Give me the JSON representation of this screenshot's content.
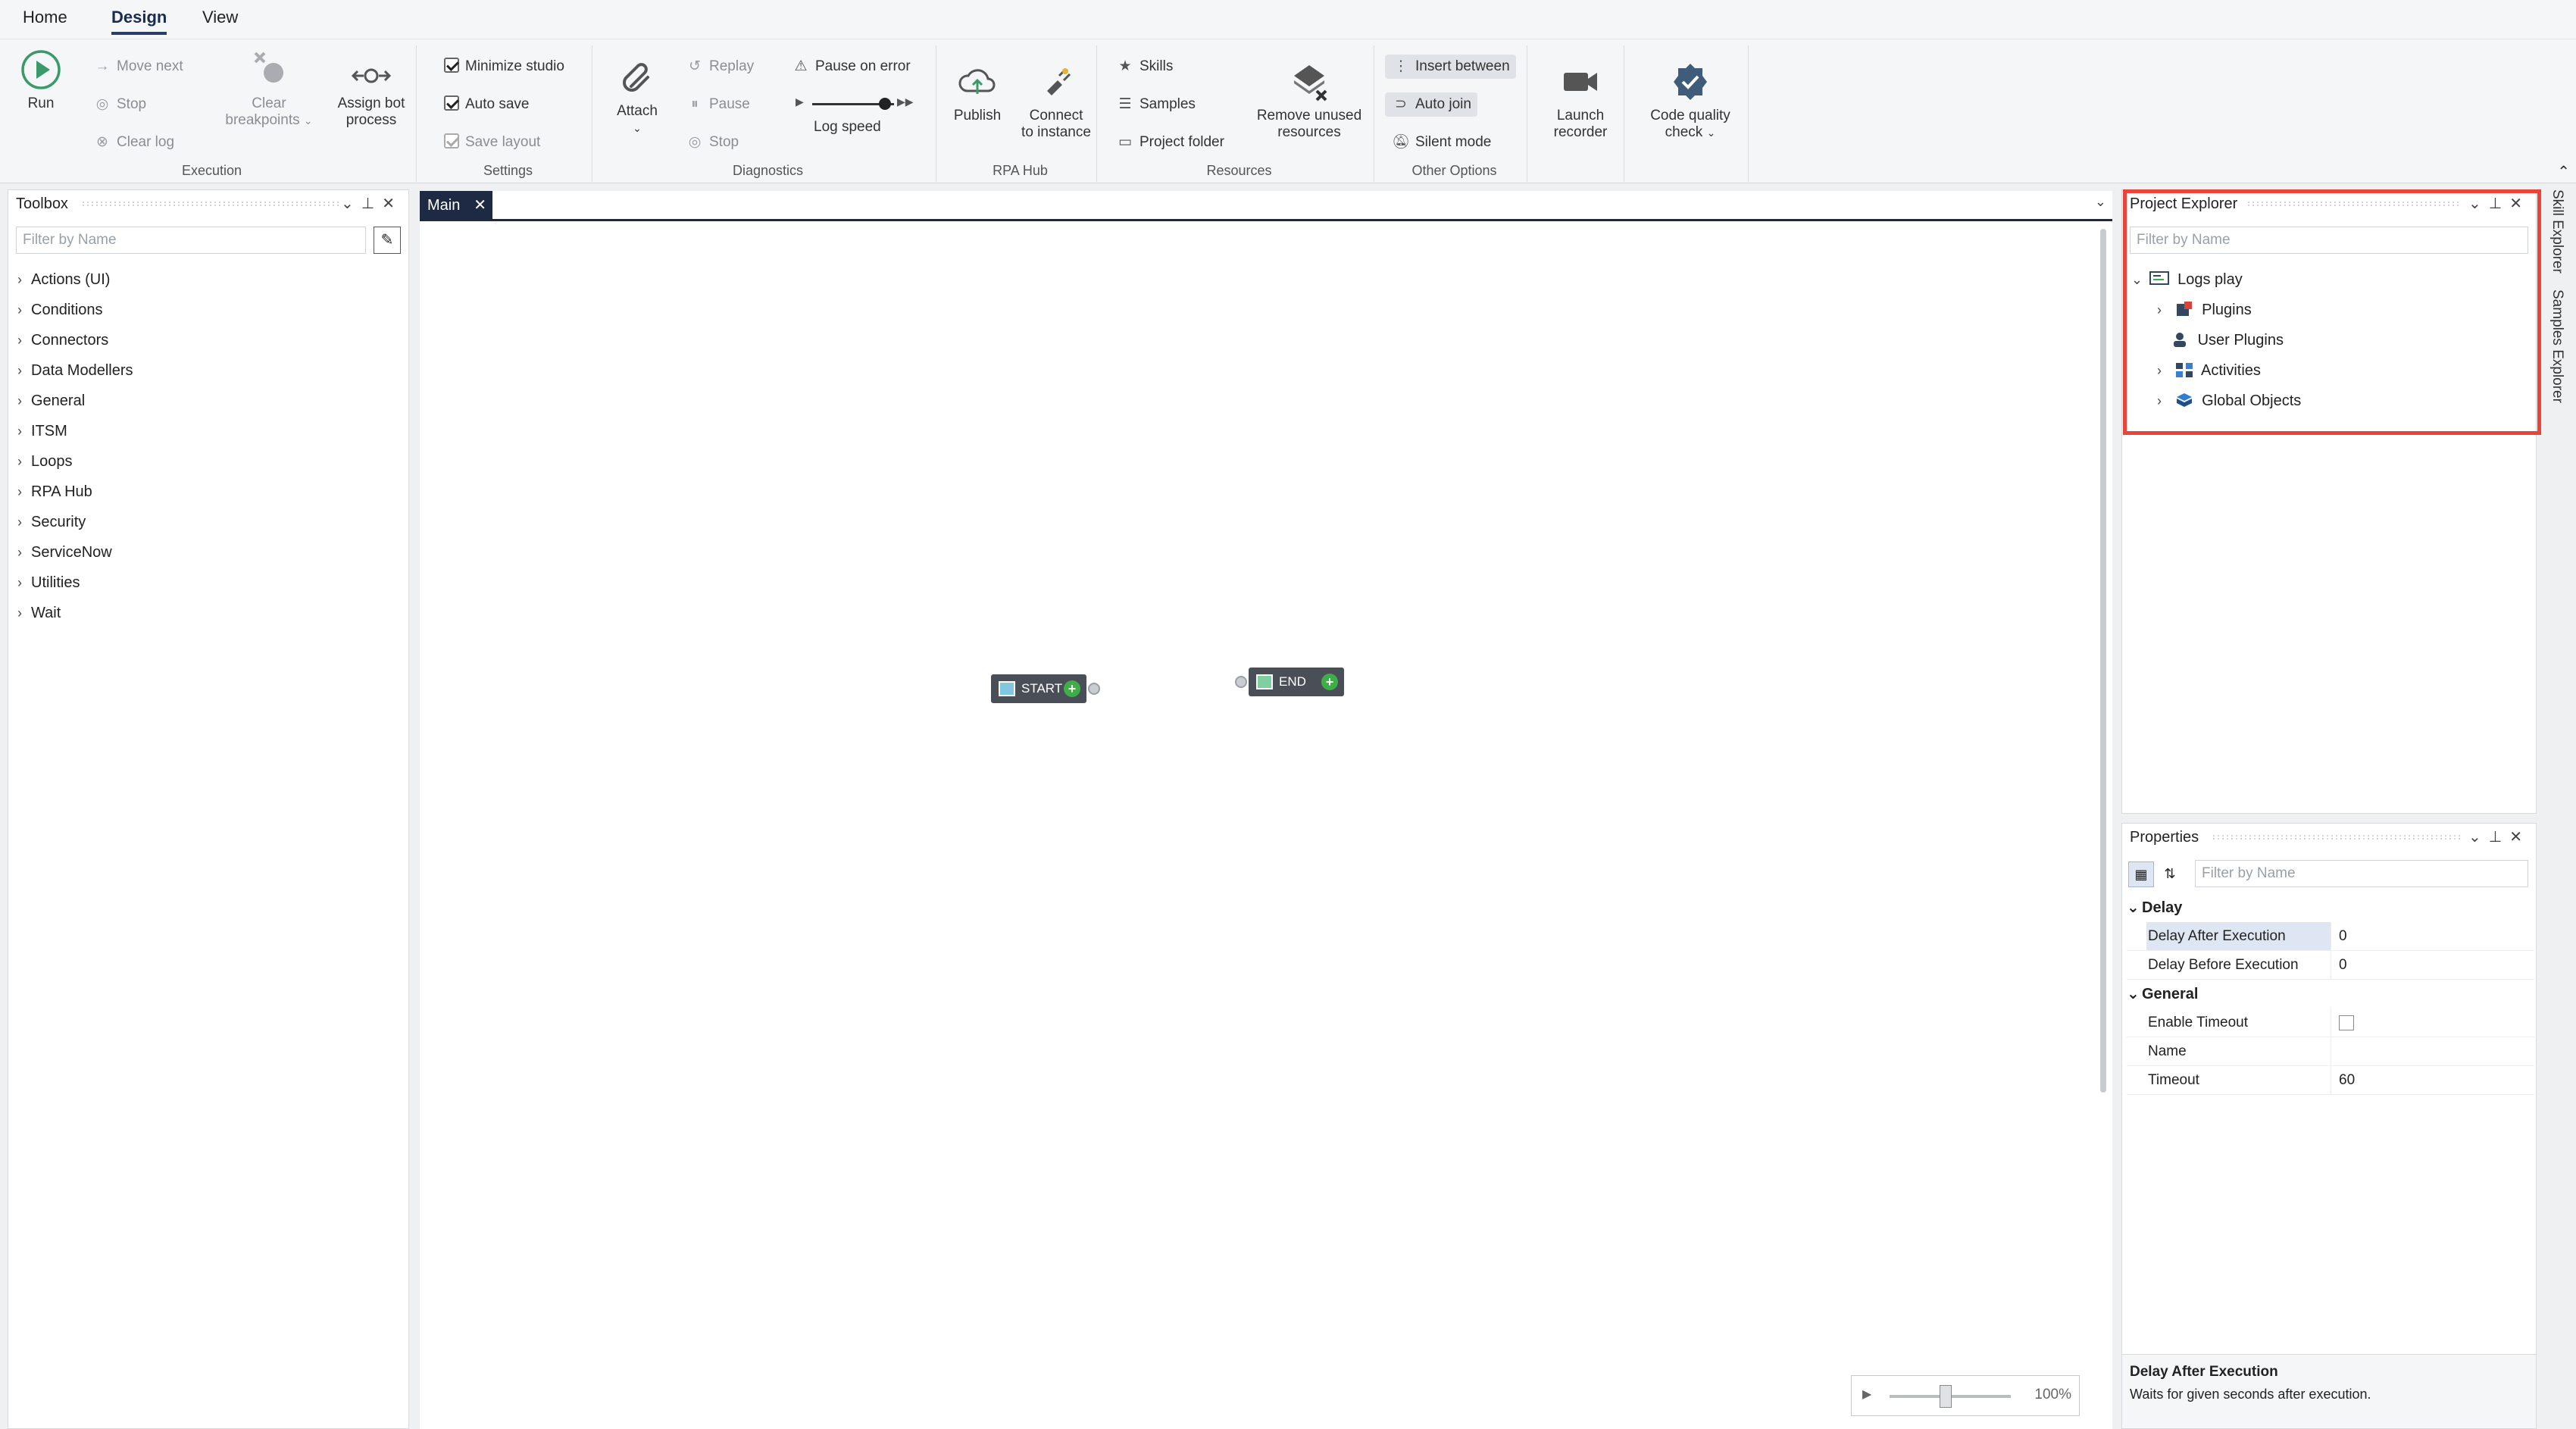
{
  "tabs": [
    "Home",
    "Design",
    "View"
  ],
  "active_tab": "Design",
  "ribbon": {
    "execution": {
      "label": "Execution",
      "run": "Run",
      "move_next": "Move next",
      "stop": "Stop",
      "clear_log": "Clear log",
      "clear_breakpoints_1": "Clear",
      "clear_breakpoints_2": "breakpoints",
      "assign_bot_1": "Assign bot",
      "assign_bot_2": "process"
    },
    "settings": {
      "label": "Settings",
      "minimize_studio": "Minimize studio",
      "auto_save": "Auto save",
      "save_layout": "Save layout"
    },
    "diagnostics": {
      "label": "Diagnostics",
      "attach": "Attach",
      "replay": "Replay",
      "pause": "Pause",
      "stop": "Stop",
      "pause_on_error": "Pause on error",
      "log_speed": "Log speed"
    },
    "rpa_hub": {
      "label": "RPA Hub",
      "publish": "Publish",
      "connect_1": "Connect",
      "connect_2": "to instance"
    },
    "resources": {
      "label": "Resources",
      "skills": "Skills",
      "samples": "Samples",
      "project_folder": "Project folder",
      "remove_unused_1": "Remove unused",
      "remove_unused_2": "resources"
    },
    "other_options": {
      "label": "Other Options",
      "insert_between": "Insert between",
      "auto_join": "Auto join",
      "silent_mode": "Silent mode"
    },
    "launch_recorder_1": "Launch",
    "launch_recorder_2": "recorder",
    "code_quality_1": "Code quality",
    "code_quality_2": "check"
  },
  "toolbox": {
    "title": "Toolbox",
    "filter_placeholder": "Filter by Name",
    "items": [
      "Actions (UI)",
      "Conditions",
      "Connectors",
      "Data Modellers",
      "General",
      "ITSM",
      "Loops",
      "RPA Hub",
      "Security",
      "ServiceNow",
      "Utilities",
      "Wait"
    ]
  },
  "document": {
    "tab": "Main",
    "nodes": {
      "start": "START",
      "end": "END"
    },
    "zoom": "100%"
  },
  "project_explorer": {
    "title": "Project Explorer",
    "filter_placeholder": "Filter by Name",
    "root": "Logs play",
    "children": [
      "Plugins",
      "User Plugins",
      "Activities",
      "Global Objects"
    ]
  },
  "properties": {
    "title": "Properties",
    "filter_placeholder": "Filter by Name",
    "categories": [
      {
        "name": "Delay",
        "rows": [
          {
            "name": "Delay After Execution",
            "value": "0"
          },
          {
            "name": "Delay Before Execution",
            "value": "0"
          }
        ]
      },
      {
        "name": "General",
        "rows": [
          {
            "name": "Enable Timeout",
            "value": ""
          },
          {
            "name": "Name",
            "value": ""
          },
          {
            "name": "Timeout",
            "value": "60"
          }
        ]
      }
    ],
    "desc_title": "Delay After Execution",
    "desc_text": "Waits for given seconds after execution."
  },
  "side_tabs": [
    "Skill Explorer",
    "Samples Explorer"
  ],
  "colors": {
    "highlight": "#e8443a",
    "accent_dark": "#1e2a44",
    "run_green": "#3c9a6a",
    "plus_green": "#3fae49"
  },
  "icons": {
    "run": "play-circle-icon",
    "attach": "paperclip-icon",
    "publish": "cloud-upload-icon",
    "recorder": "video-camera-icon",
    "quality": "shield-check-icon"
  }
}
